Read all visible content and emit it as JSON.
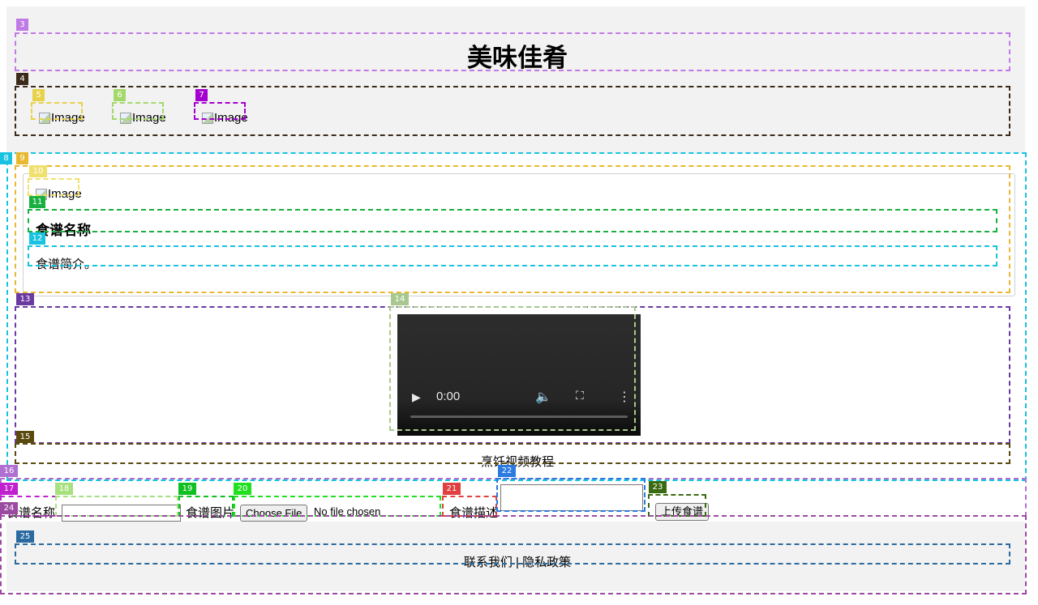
{
  "header": {
    "title": "美味佳肴",
    "images": [
      {
        "alt": "Image"
      },
      {
        "alt": "Image"
      },
      {
        "alt": "Image"
      }
    ]
  },
  "recipe_card": {
    "image_alt": "Image",
    "name": "食谱名称",
    "description": "食谱简介。"
  },
  "video": {
    "time": "0:00",
    "caption": "烹饪视频教程",
    "icons": [
      "play-icon",
      "volume-muted-icon",
      "fullscreen-icon",
      "more-options-icon"
    ]
  },
  "upload_form": {
    "name_label": "食谱名称",
    "name_value": "",
    "image_label": "食谱图片",
    "choose_file_label": "Choose File",
    "no_file_text": "No file chosen",
    "description_label": "食谱描述",
    "description_value": "",
    "submit_label": "上传食谱"
  },
  "footer": {
    "contact_label": "联系我们",
    "separator": "|",
    "privacy_label": "隐私政策"
  },
  "annotation_tags": [
    {
      "label": "3",
      "color": "#c07ae6"
    },
    {
      "label": "4",
      "color": "#3b2a1a"
    },
    {
      "label": "5",
      "color": "#e8d24a"
    },
    {
      "label": "6",
      "color": "#a4d86a"
    },
    {
      "label": "7",
      "color": "#a400d0"
    },
    {
      "label": "8",
      "color": "#18c2e0"
    },
    {
      "label": "9",
      "color": "#e8b830"
    },
    {
      "label": "10",
      "color": "#f0e070"
    },
    {
      "label": "11",
      "color": "#18b040"
    },
    {
      "label": "12",
      "color": "#18c2e0"
    },
    {
      "label": "13",
      "color": "#6a3aa0"
    },
    {
      "label": "14",
      "color": "#a8c890"
    },
    {
      "label": "15",
      "color": "#5a4a10"
    },
    {
      "label": "16",
      "color": "#b070d0"
    },
    {
      "label": "17",
      "color": "#c020d0"
    },
    {
      "label": "18",
      "color": "#a8e080"
    },
    {
      "label": "19",
      "color": "#10c020"
    },
    {
      "label": "20",
      "color": "#20e020"
    },
    {
      "label": "21",
      "color": "#e04040"
    },
    {
      "label": "22",
      "color": "#2a7ae0"
    },
    {
      "label": "23",
      "color": "#3a6a10"
    },
    {
      "label": "24",
      "color": "#9a4aa0"
    },
    {
      "label": "25",
      "color": "#2a6aa0"
    }
  ]
}
